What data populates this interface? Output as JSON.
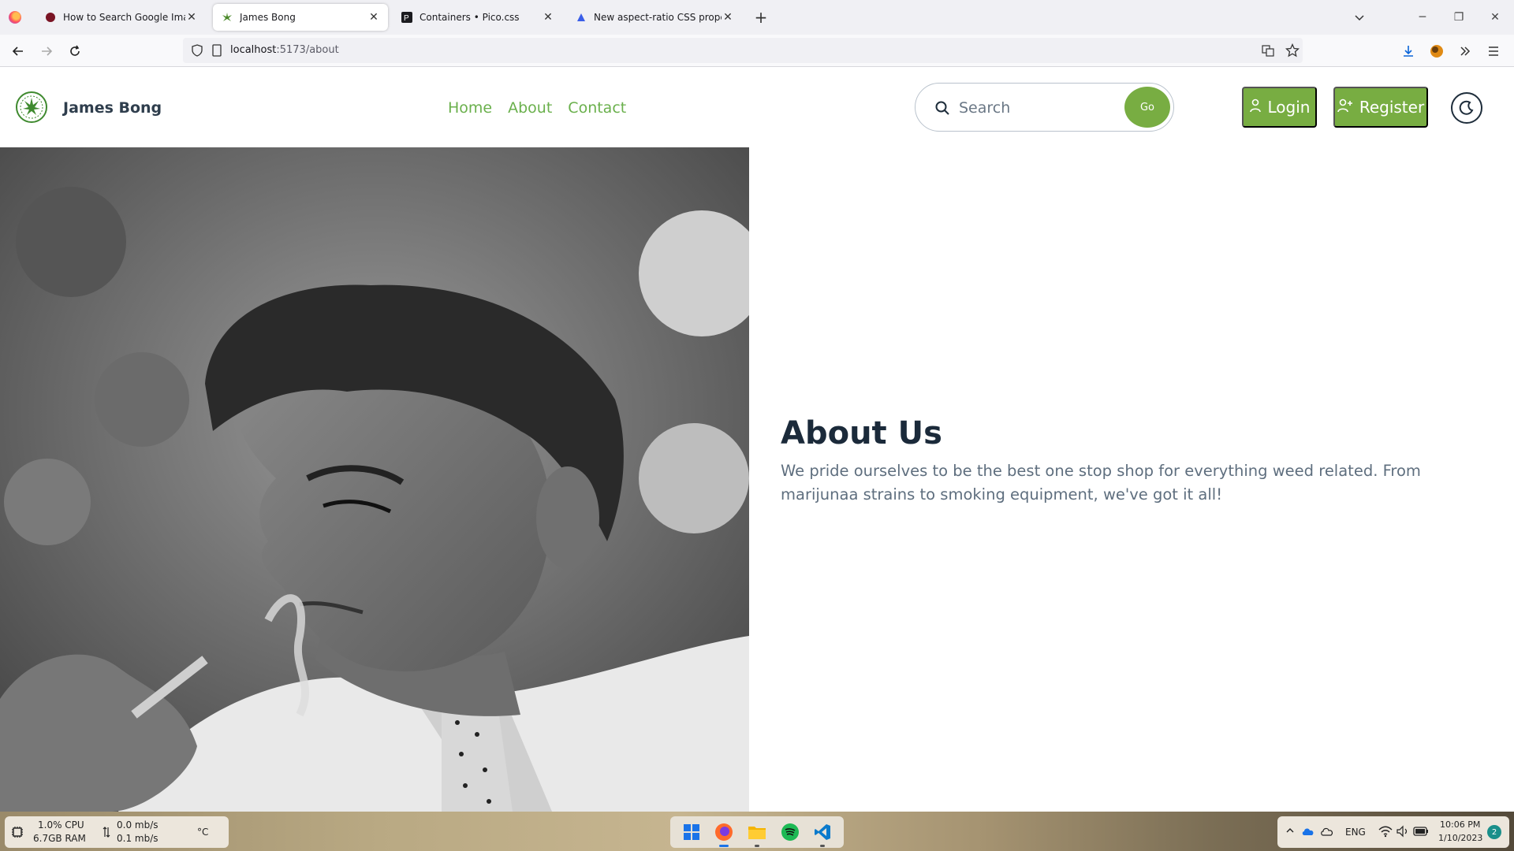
{
  "browser": {
    "tabs": [
      {
        "title": "How to Search Google Images",
        "active": false
      },
      {
        "title": "James Bong",
        "active": true
      },
      {
        "title": "Containers • Pico.css",
        "active": false
      },
      {
        "title": "New aspect-ratio CSS property",
        "active": false
      }
    ],
    "url_host": "localhost",
    "url_path": ":5173/about"
  },
  "site": {
    "brand": "James Bong",
    "nav": [
      "Home",
      "About",
      "Contact"
    ],
    "search_placeholder": "Search",
    "go_label": "Go",
    "login_label": "Login",
    "register_label": "Register",
    "accent_color": "#78ad42"
  },
  "about": {
    "heading": "About Us",
    "body": "We pride ourselves to be the best one stop shop for everything weed related.  From marijunaa strains to smoking equipment, we've got it all!"
  },
  "taskbar": {
    "cpu": "1.0% CPU",
    "ram": "6.7GB RAM",
    "net_down": "0.0 mb/s",
    "net_up": "0.1 mb/s",
    "temp": "°C",
    "lang": "ENG",
    "time": "10:06 PM",
    "date": "1/10/2023",
    "notifications": "2"
  }
}
